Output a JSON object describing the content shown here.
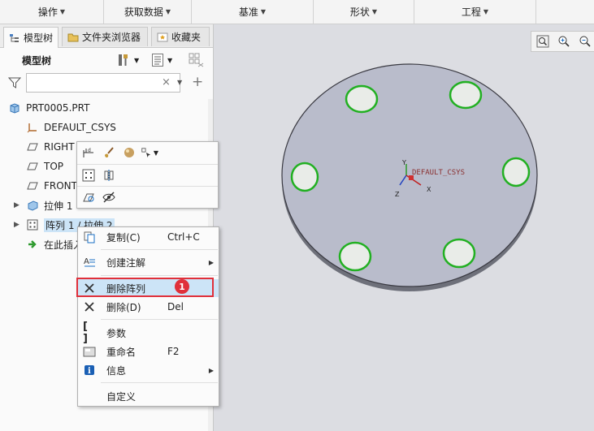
{
  "ribbon": {
    "tabs": [
      {
        "label": "操作"
      },
      {
        "label": "获取数据"
      },
      {
        "label": "基准"
      },
      {
        "label": "形状"
      },
      {
        "label": "工程"
      }
    ]
  },
  "navigator": {
    "tabs": [
      {
        "label": "模型树",
        "icon": "model-tree-icon"
      },
      {
        "label": "文件夹浏览器",
        "icon": "folder-icon"
      },
      {
        "label": "收藏夹",
        "icon": "favorites-icon"
      }
    ],
    "tree_title": "模型树",
    "search": {
      "value": "",
      "placeholder": ""
    },
    "tree": [
      {
        "label": "PRT0005.PRT",
        "icon": "part-icon"
      },
      {
        "label": "DEFAULT_CSYS",
        "icon": "csys-icon"
      },
      {
        "label": "RIGHT",
        "icon": "datum-plane-icon"
      },
      {
        "label": "TOP",
        "icon": "datum-plane-icon"
      },
      {
        "label": "FRONT",
        "icon": "datum-plane-icon"
      },
      {
        "label": "拉伸 1",
        "icon": "extrude-icon"
      },
      {
        "label": "阵列 1 / 拉伸 2",
        "icon": "pattern-icon"
      },
      {
        "label": "在此插入",
        "icon": "insert-here-icon"
      }
    ]
  },
  "context_menu": {
    "items": [
      {
        "label": "复制(C)",
        "shortcut": "Ctrl+C",
        "icon": "copy-icon"
      },
      {
        "label": "创建注解",
        "shortcut": "",
        "icon": "annotation-icon"
      },
      {
        "label": "删除阵列",
        "shortcut": "",
        "icon": "delete-pattern-icon"
      },
      {
        "label": "删除(D)",
        "shortcut": "Del",
        "icon": "delete-icon"
      },
      {
        "label": "参数",
        "shortcut": "",
        "icon": "parameters-icon"
      },
      {
        "label": "重命名",
        "shortcut": "F2",
        "icon": "rename-icon"
      },
      {
        "label": "信息",
        "shortcut": "",
        "icon": "info-icon"
      },
      {
        "label": "自定义",
        "shortcut": "",
        "icon": ""
      }
    ],
    "highlighted_item": "删除阵列",
    "badge": "1"
  },
  "graphics": {
    "csys_label": "DEFAULT_CSYS",
    "axis_labels": {
      "x": "X",
      "y": "Y",
      "z": "Z"
    }
  },
  "colors": {
    "accent_red": "#e0303a",
    "highlight": "#cce4f7",
    "hole_green": "#22b022",
    "disk": "#b9bccb"
  }
}
